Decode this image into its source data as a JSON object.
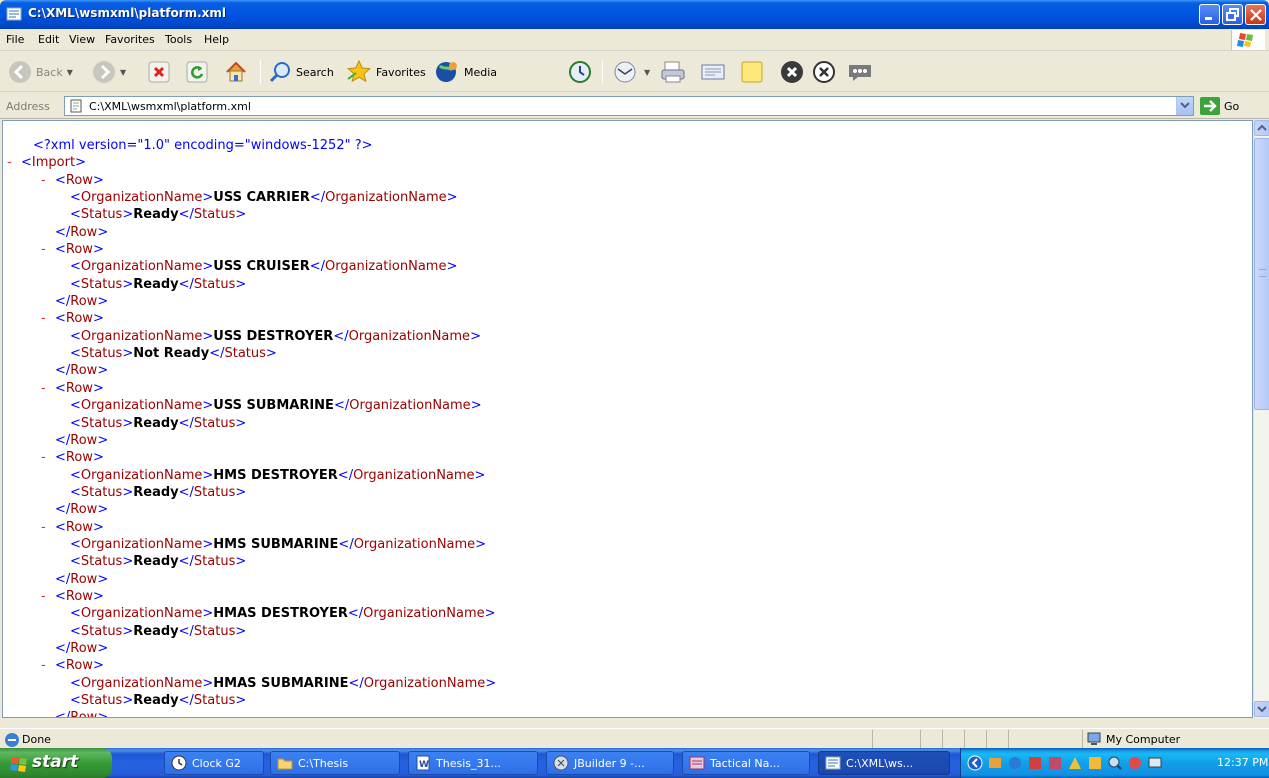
{
  "window": {
    "title": "C:\\XML\\wsmxml\\platform.xml",
    "controls": [
      "minimize",
      "maximize",
      "close"
    ]
  },
  "menu": [
    "File",
    "Edit",
    "View",
    "Favorites",
    "Tools",
    "Help"
  ],
  "toolbar": {
    "back_label": "Back",
    "search_label": "Search",
    "favorites_label": "Favorites",
    "media_label": "Media"
  },
  "address": {
    "label": "Address",
    "url": "C:\\XML\\wsmxml\\platform.xml",
    "go_label": "Go"
  },
  "xml": {
    "declaration": "<?xml version=\"1.0\" encoding=\"windows-1252\" ?>",
    "root_tag": "Import",
    "row_tag": "Row",
    "name_tag": "OrganizationName",
    "status_tag": "Status",
    "rows": [
      {
        "name": "USS CARRIER",
        "status": "Ready"
      },
      {
        "name": "USS CRUISER",
        "status": "Ready"
      },
      {
        "name": "USS DESTROYER",
        "status": "Not Ready"
      },
      {
        "name": "USS SUBMARINE",
        "status": "Ready"
      },
      {
        "name": "HMS DESTROYER",
        "status": "Ready"
      },
      {
        "name": "HMS SUBMARINE",
        "status": "Ready"
      },
      {
        "name": "HMAS DESTROYER",
        "status": "Ready"
      },
      {
        "name": "HMAS SUBMARINE",
        "status": "Ready"
      }
    ]
  },
  "status": {
    "text": "Done",
    "zone": "My Computer"
  },
  "taskbar": {
    "start_label": "start",
    "tasks": [
      {
        "label": "Clock G2",
        "active": false
      },
      {
        "label": "C:\\Thesis",
        "active": false
      },
      {
        "label": "Thesis_31...",
        "active": false
      },
      {
        "label": "JBuilder 9 -...",
        "active": false
      },
      {
        "label": "Tactical Na...",
        "active": false
      },
      {
        "label": "C:\\XML\\ws...",
        "active": true
      }
    ],
    "clock": "12:37 PM"
  },
  "colors": {
    "xml_markup": "#0000ff",
    "xml_tagname": "#990000",
    "xml_collapse": "#e03030",
    "titlebar": "#0054e3"
  }
}
